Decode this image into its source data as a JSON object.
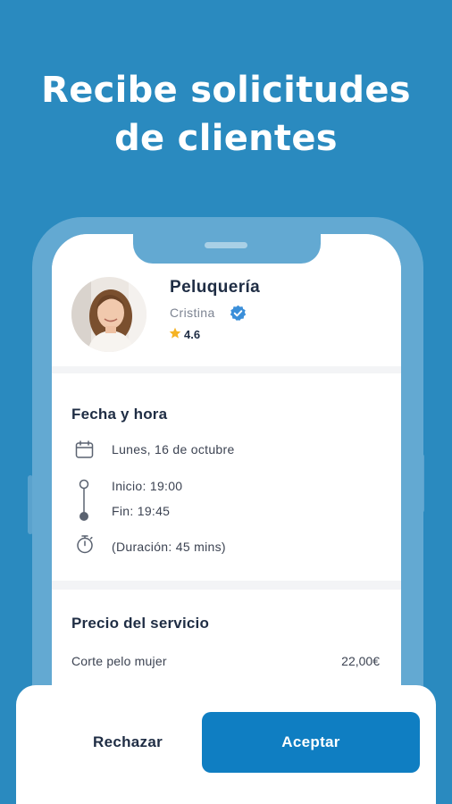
{
  "headline": {
    "line1": "Recibe solicitudes",
    "line2": "de clientes"
  },
  "profile": {
    "service": "Peluquería",
    "name": "Cristina",
    "rating": "4.6",
    "icons": [
      "avatar-photo",
      "verified-badge-icon",
      "star-icon"
    ]
  },
  "schedule": {
    "title": "Fecha y hora",
    "date": "Lunes, 16 de octubre",
    "start": "Inicio: 19:00",
    "end": "Fin: 19:45",
    "duration": "(Duración: 45 mins)",
    "icons": [
      "calendar-icon",
      "timeline-icon",
      "stopwatch-icon"
    ]
  },
  "price": {
    "title": "Precio del servicio",
    "items": [
      {
        "label": "Corte pelo mujer",
        "value": "22,00€"
      }
    ]
  },
  "actions": {
    "reject_label": "Rechazar",
    "accept_label": "Aceptar"
  },
  "colors": {
    "background": "#2a8abf",
    "phone_frame": "#63a9d2",
    "accent": "#0f7ec2",
    "text_dark": "#1f2d44",
    "verified": "#3b8fd9",
    "star": "#f5b324"
  }
}
